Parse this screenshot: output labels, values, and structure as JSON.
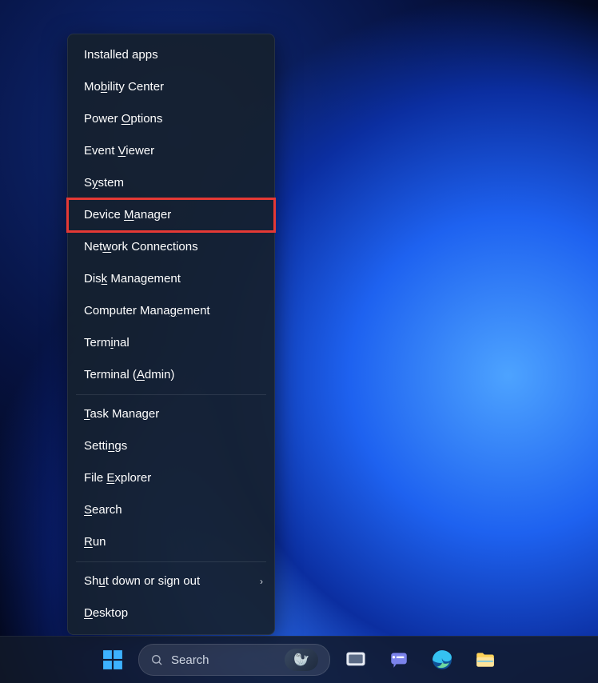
{
  "menu": {
    "items": [
      {
        "pre": "",
        "u": "",
        "post": "Installed apps"
      },
      {
        "pre": "Mo",
        "u": "b",
        "post": "ility Center"
      },
      {
        "pre": "Power ",
        "u": "O",
        "post": "ptions"
      },
      {
        "pre": "Event ",
        "u": "V",
        "post": "iewer"
      },
      {
        "pre": "S",
        "u": "y",
        "post": "stem"
      },
      {
        "pre": "Device ",
        "u": "M",
        "post": "anager",
        "highlight": true
      },
      {
        "pre": "Net",
        "u": "w",
        "post": "ork Connections"
      },
      {
        "pre": "Dis",
        "u": "k",
        "post": " Management"
      },
      {
        "pre": "Computer Mana",
        "u": "g",
        "post": "ement"
      },
      {
        "pre": "Term",
        "u": "i",
        "post": "nal"
      },
      {
        "pre": "Terminal (",
        "u": "A",
        "post": "dmin)"
      },
      {
        "sep": true
      },
      {
        "pre": "",
        "u": "T",
        "post": "ask Manager"
      },
      {
        "pre": "Setti",
        "u": "n",
        "post": "gs"
      },
      {
        "pre": "File ",
        "u": "E",
        "post": "xplorer"
      },
      {
        "pre": "",
        "u": "S",
        "post": "earch"
      },
      {
        "pre": "",
        "u": "R",
        "post": "un"
      },
      {
        "sep": true
      },
      {
        "pre": "Sh",
        "u": "u",
        "post": "t down or sign out",
        "submenu": true
      },
      {
        "pre": "",
        "u": "D",
        "post": "esktop"
      }
    ]
  },
  "taskbar": {
    "search_placeholder": "Search"
  }
}
